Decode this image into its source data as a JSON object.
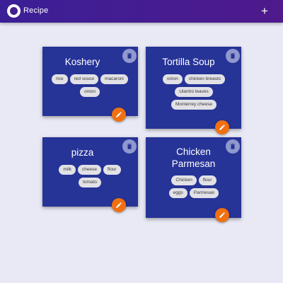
{
  "appbar": {
    "title": "Recipe",
    "add_label": "+",
    "logo_icon": "circle-logo-icon",
    "color": "#43208f"
  },
  "cards": [
    {
      "title": "Koshery",
      "ingredients": [
        "rice",
        "red souce",
        "macaroni",
        "onion"
      ]
    },
    {
      "title": "Tortilla Soup",
      "ingredients": [
        "onion",
        "chicken breasts",
        "cilantro leaves",
        "Monterrey cheese"
      ]
    },
    {
      "title": "pizza",
      "ingredients": [
        "milk",
        "cheese",
        "flour",
        "tomato"
      ]
    },
    {
      "title": "Chicken Parmesan",
      "ingredients": [
        "Chicken",
        "flour",
        "eggs",
        "Parmesan"
      ]
    }
  ],
  "colors": {
    "card_bg": "#263397",
    "delete_bg": "#8f98cf",
    "edit_bg": "#f07012",
    "chip_bg": "#e1e1e6"
  },
  "icons": {
    "delete": "trash-icon",
    "edit": "pencil-icon"
  }
}
